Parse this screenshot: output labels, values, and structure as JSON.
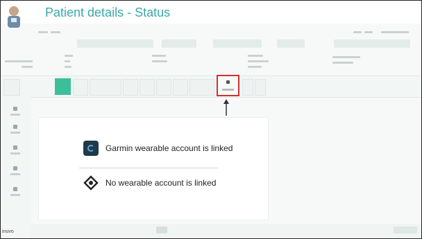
{
  "header": {
    "title": "Patient details - Status"
  },
  "legend": {
    "items": [
      {
        "label": "Garmin wearable account is linked",
        "icon": "garmin-icon"
      },
      {
        "label": "No wearable account is linked",
        "icon": "no-wearable-icon"
      }
    ]
  },
  "highlight": {
    "target": "status-button",
    "color": "#d32f2f"
  },
  "colors": {
    "accent": "#3aa9a9",
    "green": "#3bbf9a"
  },
  "footer": {
    "logo": "inuvo"
  }
}
